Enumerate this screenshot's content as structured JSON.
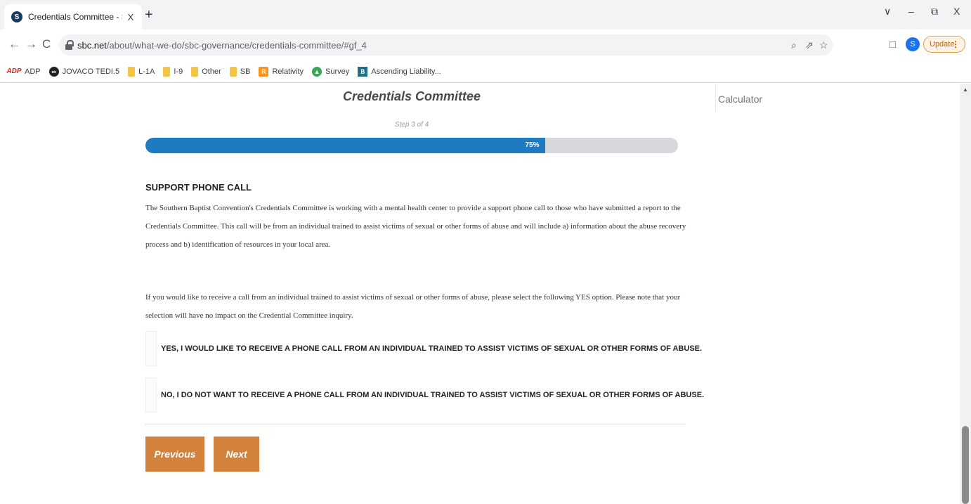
{
  "browser": {
    "tab": {
      "favicon": "S",
      "title": "Credentials Committee - SBC.net",
      "close": "X"
    },
    "new_tab": "+",
    "window_controls": {
      "tab_search": "∨",
      "minimize": "–",
      "restore": "⧉",
      "close": "X"
    },
    "nav": {
      "back": "←",
      "forward": "→",
      "reload": "C"
    },
    "url": {
      "host": "sbc.net",
      "path": "/about/what-we-do/sbc-governance/credentials-committee/#gf_4"
    },
    "omnibox_icons": {
      "zoom": "⌕",
      "share": "⇗",
      "bookmark": "☆"
    },
    "side_panel_icon": "□",
    "profile_initial": "S",
    "update_label": "Update",
    "update_menu": "⋮",
    "bookmarks": [
      {
        "label": "ADP",
        "icon": "adp-icon",
        "glyph": "ADP"
      },
      {
        "label": "JOVACO TEDI.5",
        "icon": "jovaco-icon",
        "glyph": "∞"
      },
      {
        "label": "L-1A",
        "icon": "folder-icon",
        "glyph": ""
      },
      {
        "label": "I-9",
        "icon": "folder-icon",
        "glyph": ""
      },
      {
        "label": "Other",
        "icon": "folder-icon",
        "glyph": ""
      },
      {
        "label": "SB",
        "icon": "folder-icon",
        "glyph": ""
      },
      {
        "label": "Relativity",
        "icon": "relativity-icon",
        "glyph": "R"
      },
      {
        "label": "Survey",
        "icon": "survey-icon",
        "glyph": "▲"
      },
      {
        "label": "Ascending Liability...",
        "icon": "ascending-icon",
        "glyph": "B"
      }
    ]
  },
  "page": {
    "form_title": "Credentials Committee",
    "sidebar_label": "Calculator",
    "step_label": "Step 3 of 4",
    "progress": {
      "percent": 75,
      "label": "75%"
    },
    "section_title": "SUPPORT PHONE CALL",
    "paragraph_1": "The Southern Baptist Convention's Credentials Committee is working with a mental health center to provide a support phone call to those who have submitted a report to the Credentials Committee. This call will be from an individual trained to assist victims of sexual or other forms of abuse and will include a) information about the abuse recovery process and b) identification of resources in your local area.",
    "paragraph_2": "If you would like to receive a call from an individual trained to assist victims of sexual or other forms of abuse, please select the following YES option. Please note that your selection will have no impact on the Credential Committee inquiry.",
    "choices": [
      {
        "label": "YES, I WOULD LIKE TO RECEIVE A PHONE CALL FROM AN INDIVIDUAL TRAINED TO ASSIST VICTIMS OF SEXUAL OR OTHER FORMS OF ABUSE."
      },
      {
        "label": "NO, I DO NOT WANT TO RECEIVE A PHONE CALL FROM AN INDIVIDUAL TRAINED TO ASSIST VICTIMS OF SEXUAL OR OTHER FORMS OF ABUSE."
      }
    ],
    "buttons": {
      "previous": "Previous",
      "next": "Next"
    },
    "scroll_up": "▲"
  },
  "colors": {
    "progress_fill": "#1f7bc1",
    "button": "#d2823a",
    "update_accent": "#e8a24a"
  }
}
